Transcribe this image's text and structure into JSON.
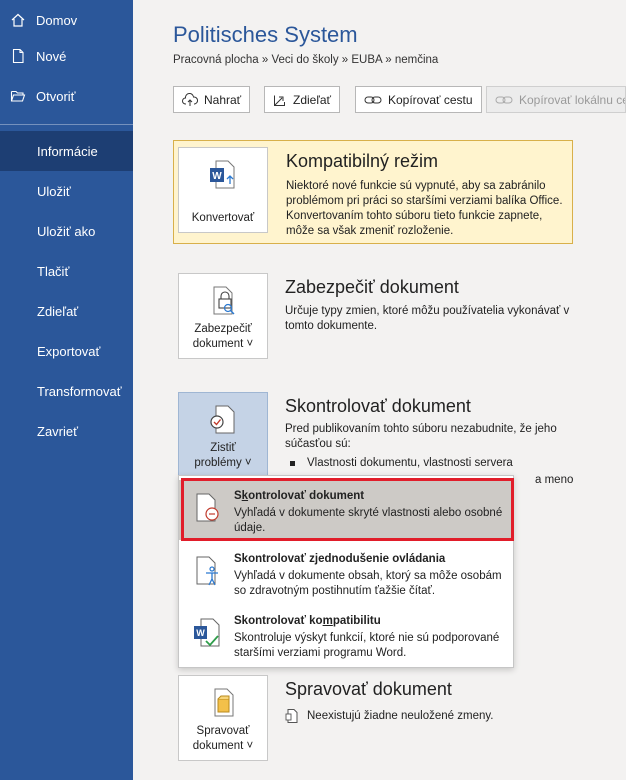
{
  "sidebar": {
    "items": [
      {
        "label": "Domov",
        "icon": "home-icon"
      },
      {
        "label": "Nové",
        "icon": "new-document-icon"
      },
      {
        "label": "Otvoriť",
        "icon": "folder-open-icon"
      },
      {
        "label": "Informácie"
      },
      {
        "label": "Uložiť"
      },
      {
        "label": "Uložiť ako"
      },
      {
        "label": "Tlačiť"
      },
      {
        "label": "Zdieľať"
      },
      {
        "label": "Exportovať"
      },
      {
        "label": "Transformovať"
      },
      {
        "label": "Zavrieť"
      }
    ],
    "active_index": 3
  },
  "header": {
    "title": "Politisches System",
    "breadcrumb": "Pracovná plocha » Veci do školy » EUBA » nemčina"
  },
  "toolbar": {
    "upload": "Nahrať",
    "share": "Zdieľať",
    "copy_path": "Kopírovať cestu",
    "copy_local_path": "Kopírovať lokálnu ce"
  },
  "compat": {
    "button": "Konvertovať",
    "title": "Kompatibilný režim",
    "text": "Niektoré nové funkcie sú vypnuté, aby sa zabránilo problémom pri práci so staršími verziami balíka Office. Konvertovaním tohto súboru tieto funkcie zapnete, môže sa však zmeniť rozloženie."
  },
  "protect": {
    "button_line1": "Zabezpečiť",
    "button_line2": "dokument ˅",
    "title": "Zabezpečiť dokument",
    "text": "Určuje typy zmien, ktoré môžu používatelia vykonávať v tomto dokumente."
  },
  "inspect": {
    "button_line1": "Zistiť",
    "button_line2": "problémy ˅",
    "title": "Skontrolovať dokument",
    "text": "Pred publikovaním tohto súboru nezabudnite, že jeho súčasťou sú:",
    "bullets": [
      "Vlastnosti dokumentu, vlastnosti servera",
      "a meno"
    ]
  },
  "menu": {
    "items": [
      {
        "title_pre": "S",
        "title_u": "k",
        "title_post": "ontrolovať dokument",
        "desc": "Vyhľadá v dokumente skryté vlastnosti alebo osobné údaje."
      },
      {
        "title_pre": "Skontrolovať z",
        "title_u": "j",
        "title_post": "ednodušenie ovládania",
        "desc": "Vyhľadá v dokumente obsah, ktorý sa môže osobám so zdravotným postihnutím ťažšie čítať."
      },
      {
        "title_pre": "Skontrolovať ko",
        "title_u": "m",
        "title_post": "patibilitu",
        "desc": "Skontroluje výskyt funkcií, ktoré nie sú podporované staršími verziami programu Word."
      }
    ]
  },
  "manage": {
    "button_line1": "Spravovať",
    "button_line2": "dokument ˅",
    "title": "Spravovať dokument",
    "text": "Neexistujú žiadne neuložené zmeny."
  },
  "colors": {
    "sidebar": "#2b579a",
    "sidebar_active": "#1d3e73",
    "compat_bg": "#fff4ce",
    "highlight_frame": "#e11d2a"
  }
}
